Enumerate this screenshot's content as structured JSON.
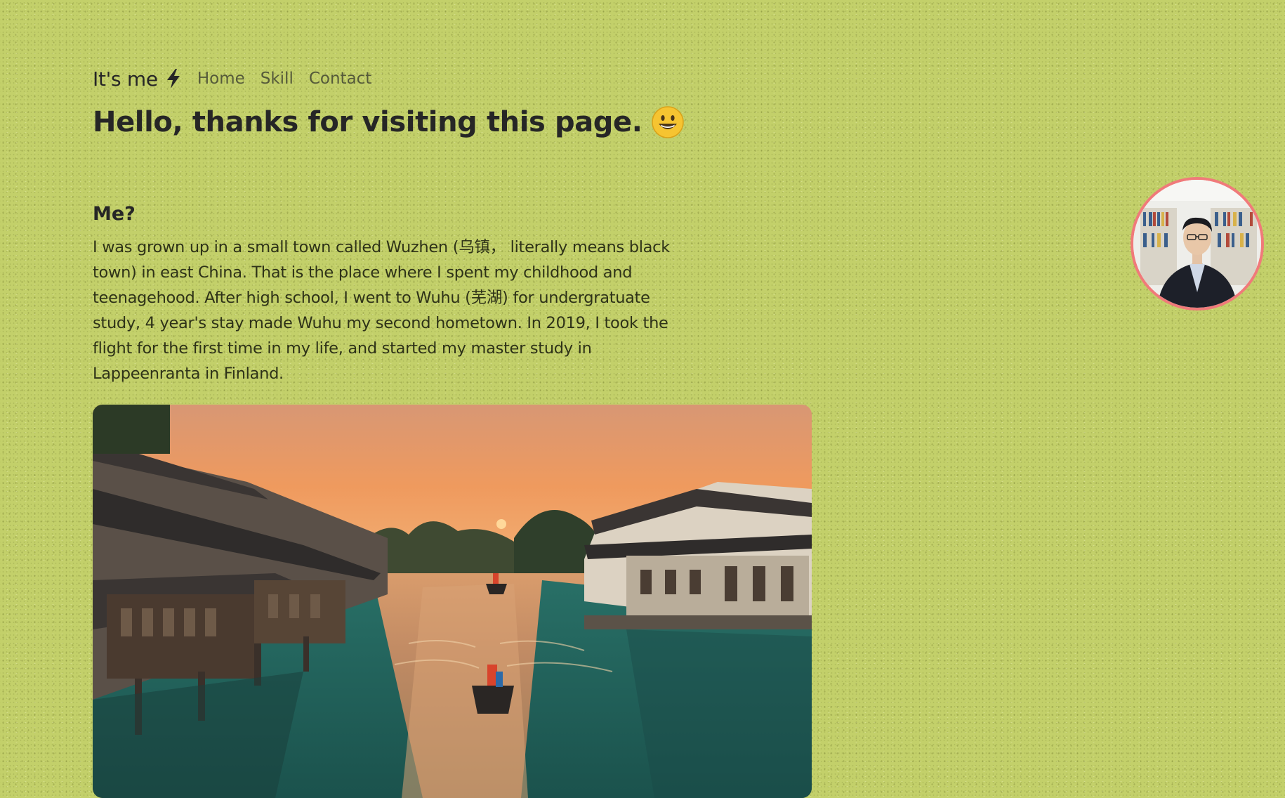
{
  "nav": {
    "brand_label": "It's me",
    "brand_icon": "lightning-bolt-icon",
    "links": [
      "Home",
      "Skill",
      "Contact"
    ]
  },
  "hero": {
    "title": "Hello, thanks for visiting this page.",
    "emoji_icon": "smiley-face-icon"
  },
  "about": {
    "heading": "Me?",
    "body": "I was grown up in a small town called Wuzhen (乌镇， literally means black town) in east China. That is the place where I spent my childhood and teenagehood. After high school, I went to Wuhu (芜湖) for undergratuate study, 4 year's stay made Wuhu my second hometown. In 2019, I took the flight for the first time in my life, and started my master study in Lappeenranta in Finland."
  },
  "colors": {
    "background": "#c3d06a",
    "avatar_border": "#f07a7a",
    "text": "#262626"
  }
}
